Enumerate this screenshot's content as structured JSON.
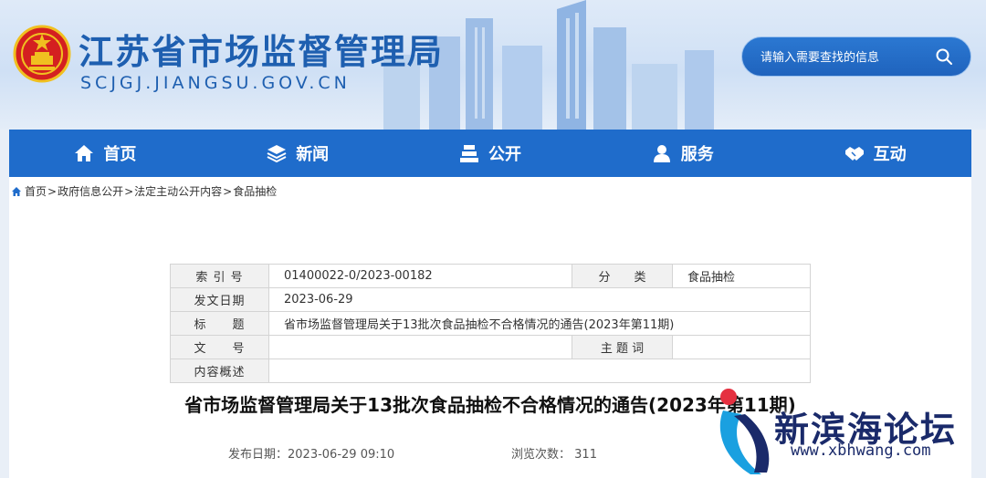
{
  "header": {
    "site_title": "江苏省市场监督管理局",
    "site_domain": "SCJGJ.JIANGSU.GOV.CN",
    "search_placeholder": "请输入需要查找的信息"
  },
  "nav": {
    "items": [
      {
        "label": "首页",
        "icon": "home-icon"
      },
      {
        "label": "新闻",
        "icon": "layers-icon"
      },
      {
        "label": "公开",
        "icon": "stack-icon"
      },
      {
        "label": "服务",
        "icon": "user-icon"
      },
      {
        "label": "互动",
        "icon": "handshake-icon"
      }
    ]
  },
  "breadcrumb": {
    "items": [
      "首页",
      "政府信息公开",
      "法定主动公开内容",
      "食品抽检"
    ],
    "separator": ">"
  },
  "meta_table": {
    "index_label": "索 引 号",
    "index_value": "01400022-0/2023-00182",
    "category_label": "分　　类",
    "category_value": "食品抽检",
    "date_label": "发文日期",
    "date_value": "2023-06-29",
    "title_label": "标　　题",
    "title_value": "省市场监督管理局关于13批次食品抽检不合格情况的通告(2023年第11期)",
    "docno_label": "文　　号",
    "docno_value": "",
    "keyword_label": "主 题 词",
    "keyword_value": "",
    "summary_label": "内容概述",
    "summary_value": ""
  },
  "article": {
    "title": "省市场监督管理局关于13批次食品抽检不合格情况的通告(2023年第11期)",
    "publish_label": "发布日期：",
    "publish_value": "2023-06-29 09:10",
    "views_label": "浏览次数：",
    "views_value": "311"
  },
  "watermark": {
    "brand": "新滨海论坛",
    "url": "www.xbhwang.com"
  },
  "colors": {
    "brand_blue": "#1f6ccb",
    "title_blue": "#1e5fb0",
    "emblem_red": "#d42020",
    "emblem_gold": "#f0c020"
  }
}
